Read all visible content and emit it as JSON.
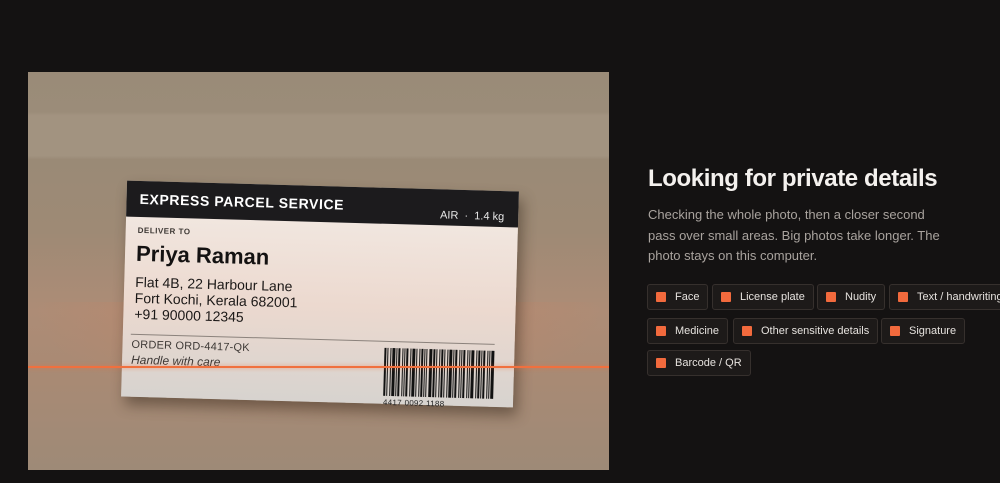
{
  "photo": {
    "label": {
      "header_title": "EXPRESS PARCEL SERVICE",
      "service": "AIR  ·  1.4 kg",
      "deliver_to_label": "DELIVER TO",
      "recipient": "Priya Raman",
      "address_line1": "Flat 4B, 22 Harbour Lane",
      "address_line2": "Fort Kochi, Kerala 682001",
      "phone": "+91 90000 12345",
      "order": "ORDER  ORD-4417-QK",
      "handling": "Handle with care",
      "barcode_number": "4417 0092 1188"
    },
    "scan_color": "#f0703e"
  },
  "panel": {
    "title": "Looking for private details",
    "description": "Checking the whole photo, then a closer second pass over small areas. Big photos take longer. The photo stays on this computer.",
    "accent_color": "#f26a3d",
    "categories": [
      "Face",
      "License plate",
      "Nudity",
      "Text / handwriting",
      "Medicine",
      "Other sensitive details",
      "Signature",
      "Barcode / QR"
    ]
  }
}
